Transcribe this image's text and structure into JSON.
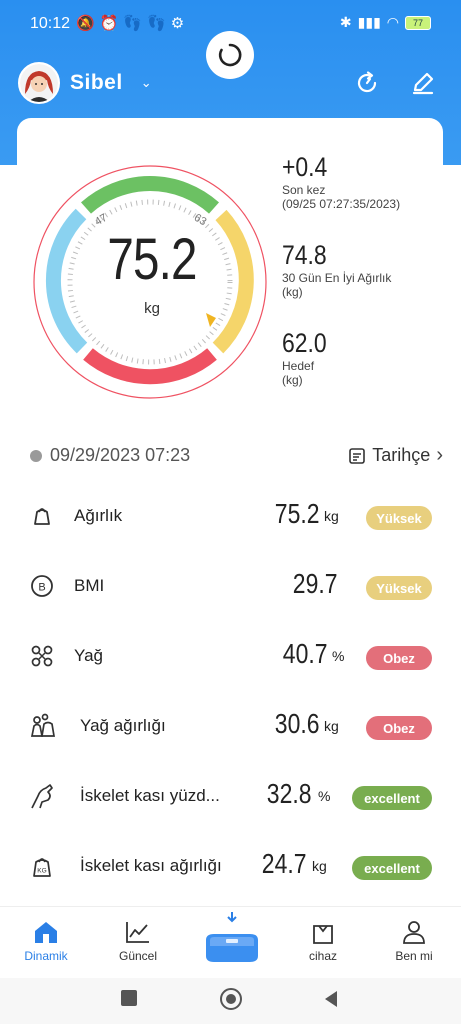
{
  "status_bar": {
    "time": "10:12",
    "battery": "77"
  },
  "header": {
    "user_name": "Sibel"
  },
  "gauge": {
    "value": "75.2",
    "unit": "kg",
    "tick_low": "47",
    "tick_high": "63"
  },
  "stats": [
    {
      "big": "+0.4",
      "line1": "Son kez",
      "line2": "(09/25 07:27:35/2023)"
    },
    {
      "big": "74.8",
      "line1": "30 Gün En İyi Ağırlık",
      "line2": "(kg)"
    },
    {
      "big": "62.0",
      "line1": "Hedef",
      "line2": "(kg)"
    }
  ],
  "measurement": {
    "datetime": "09/29/2023 07:23",
    "history_label": "Tarihçe"
  },
  "metrics": [
    {
      "label": "Ağırlık",
      "value": "75.2",
      "unit": "kg",
      "badge": "Yüksek",
      "badge_color": "#e8cf7e"
    },
    {
      "label": "BMI",
      "value": "29.7",
      "unit": "",
      "badge": "Yüksek",
      "badge_color": "#e8cf7e"
    },
    {
      "label": "Yağ",
      "value": "40.7",
      "unit": "%",
      "badge": "Obez",
      "badge_color": "#e36f7a"
    },
    {
      "label": "Yağ ağırlığı",
      "value": "30.6",
      "unit": "kg",
      "badge": "Obez",
      "badge_color": "#e36f7a"
    },
    {
      "label": "İskelet kası yüzd...",
      "value": "32.8",
      "unit": "%",
      "badge": "excellent",
      "badge_color": "#79ad4f"
    },
    {
      "label": "İskelet kası ağırlığı",
      "value": "24.7",
      "unit": "kg",
      "badge": "excellent",
      "badge_color": "#79ad4f"
    }
  ],
  "bottom_nav": [
    {
      "label": "Dinamik",
      "icon": "home-icon",
      "active": true
    },
    {
      "label": "Güncel",
      "icon": "chart-icon",
      "active": false
    },
    {
      "label": "cihaz",
      "icon": "bag-icon",
      "active": false
    },
    {
      "label": "Ben mi",
      "icon": "person-icon",
      "active": false
    }
  ],
  "colors": {
    "brand": "#2a8ff0",
    "gauge_green": "#6cc163",
    "gauge_yellow": "#f5d56a",
    "gauge_red": "#ef5262",
    "gauge_blue": "#8ad2f0"
  }
}
